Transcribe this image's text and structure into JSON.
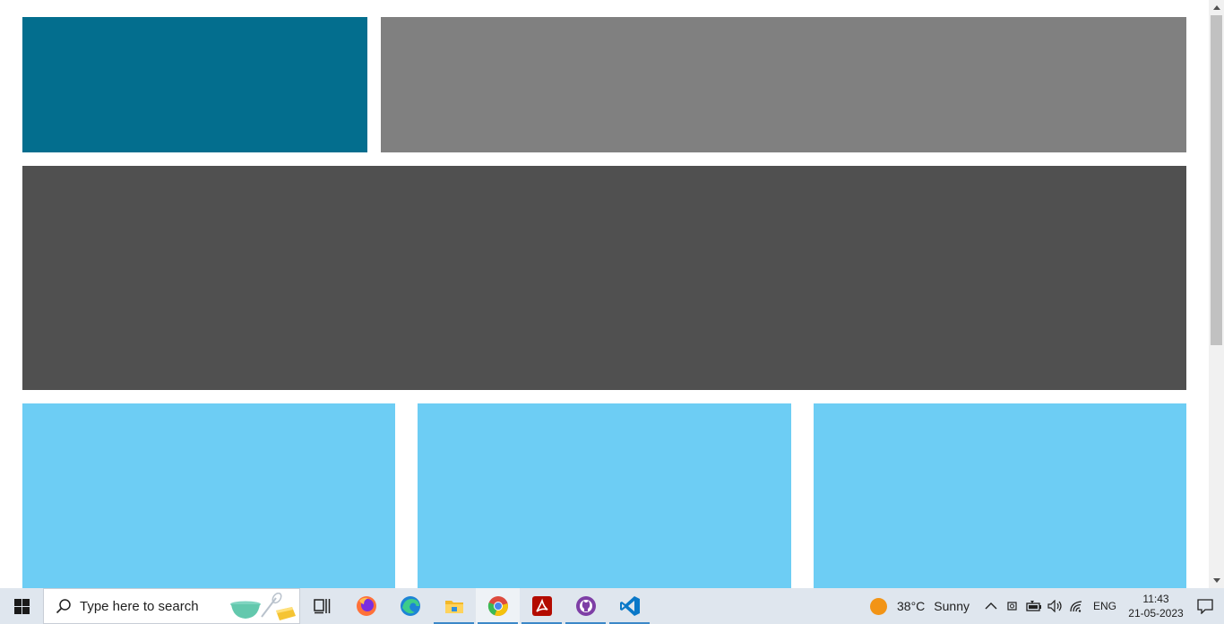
{
  "page": {
    "blocks": [
      {
        "name": "teal-banner-block",
        "color": "#036e8e"
      },
      {
        "name": "gray-banner-block",
        "color": "#808080"
      },
      {
        "name": "dark-gray-hero-block",
        "color": "#505050"
      },
      {
        "name": "light-blue-card-1",
        "color": "#6dcdf4"
      },
      {
        "name": "light-blue-card-2",
        "color": "#6dcdf4"
      },
      {
        "name": "light-blue-card-3",
        "color": "#6dcdf4"
      }
    ]
  },
  "taskbar": {
    "search_placeholder": "Type here to search",
    "apps": [
      {
        "name": "task-view-icon"
      },
      {
        "name": "firefox-icon"
      },
      {
        "name": "edge-icon"
      },
      {
        "name": "file-explorer-icon"
      },
      {
        "name": "chrome-icon"
      },
      {
        "name": "acrobat-icon"
      },
      {
        "name": "github-desktop-icon"
      },
      {
        "name": "vscode-icon"
      }
    ],
    "weather": {
      "temp": "38°C",
      "condition": "Sunny"
    },
    "language": "ENG",
    "time": "11:43",
    "date": "21-05-2023"
  },
  "colors": {
    "teal": "#036e8e",
    "gray": "#808080",
    "dark_gray": "#505050",
    "light_blue": "#6dcdf4",
    "taskbar_bg": "#dfe6ee"
  }
}
